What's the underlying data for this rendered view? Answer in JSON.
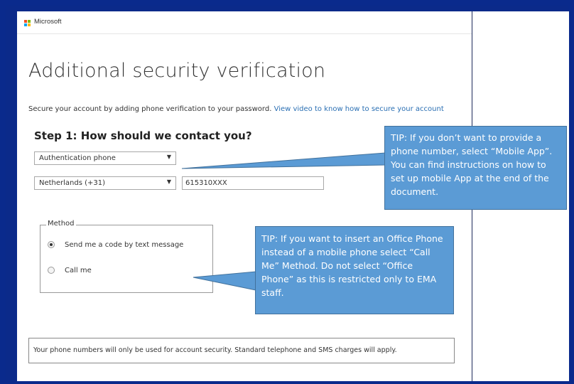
{
  "header": {
    "brand": "Microsoft"
  },
  "page": {
    "title": "Additional security verification",
    "subtitle_text": "Secure your account by adding phone verification to your password.",
    "subtitle_link": "View video to know how to secure your account"
  },
  "step1": {
    "title": "Step 1: How should we contact you?",
    "contact_method": "Authentication phone",
    "country": "Netherlands (+31)",
    "phone_number": "615310XXX"
  },
  "method": {
    "legend": "Method",
    "options": [
      {
        "label": "Send me a code by text message",
        "selected": true
      },
      {
        "label": "Call me",
        "selected": false
      }
    ]
  },
  "notice": "Your phone numbers will only be used for account security. Standard telephone and SMS charges will apply.",
  "tips": {
    "tip1": "TIP: If you don’t want to provide a phone number, select “Mobile App”. You can find instructions on how to set up mobile App at the end of the document.",
    "tip2": "TIP: If you want to insert an Office Phone instead of a mobile phone select “Call Me” Method. Do not select “Office Phone” as this is restricted only to EMA staff."
  },
  "colors": {
    "background": "#0b2a8a",
    "callout": "#5b9bd5",
    "link": "#2a6fb3",
    "ms_red": "#f25022",
    "ms_green": "#7fba00",
    "ms_blue": "#00a4ef",
    "ms_yellow": "#ffb900"
  }
}
